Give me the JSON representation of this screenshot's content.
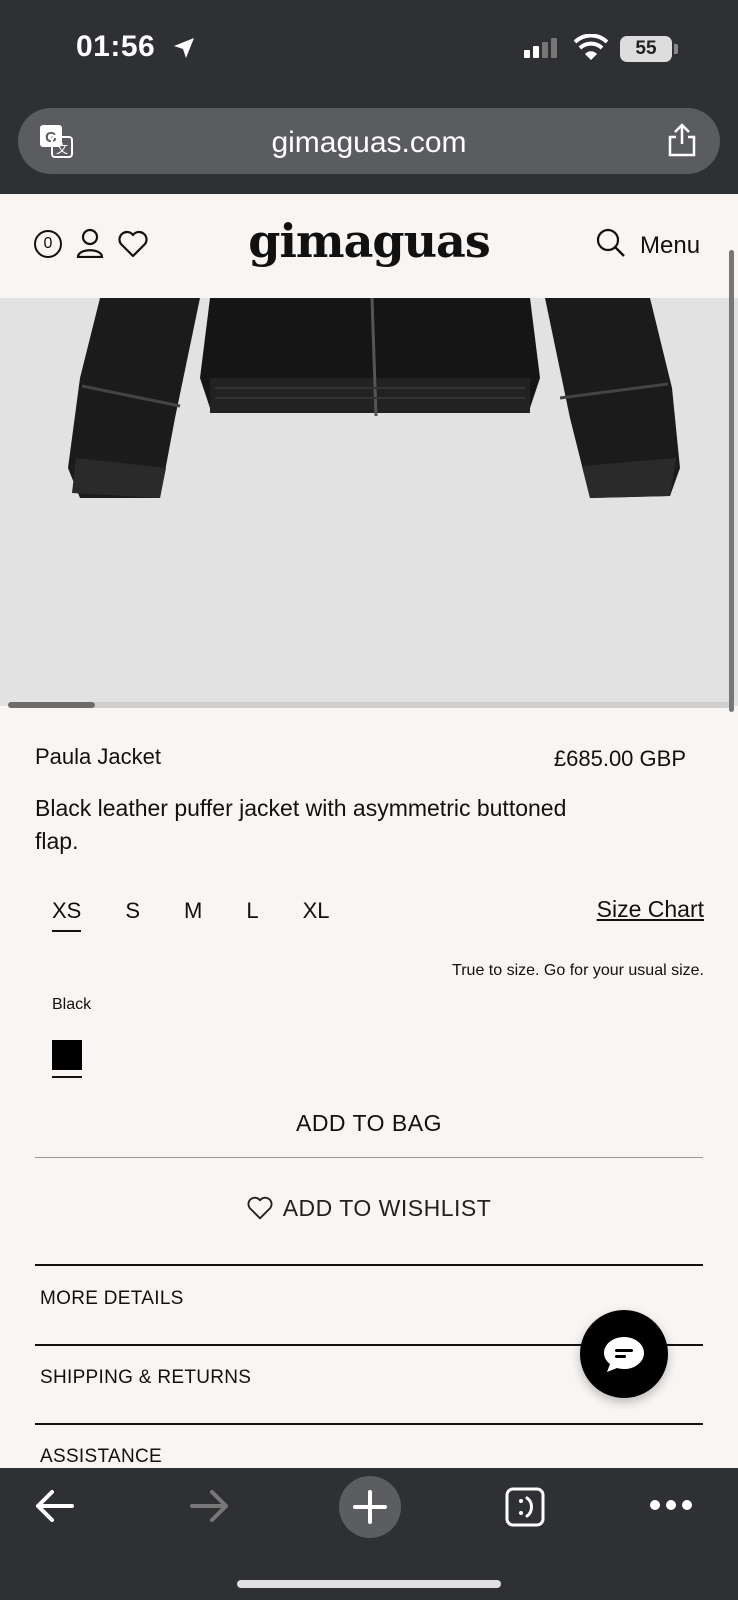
{
  "status_bar": {
    "time": "01:56",
    "battery": "55"
  },
  "browser": {
    "url": "gimaguas.com"
  },
  "header": {
    "cart_count": "0",
    "logo": "gimaguas",
    "menu_label": "Menu"
  },
  "product": {
    "name": "Paula Jacket",
    "price": "£685.00 GBP",
    "description": "Black leather puffer jacket with asymmetric buttoned flap.",
    "sizes": [
      "XS",
      "S",
      "M",
      "L",
      "XL"
    ],
    "selected_size": "XS",
    "size_chart_label": "Size Chart",
    "fit_note": "True to size. Go for your usual size.",
    "color_label": "Black",
    "swatch_color": "#000000",
    "image_carousel_progress": 0.12
  },
  "actions": {
    "add_to_bag": "ADD TO BAG",
    "add_to_wishlist": "ADD TO WISHLIST"
  },
  "accordion": [
    {
      "label": "MORE DETAILS"
    },
    {
      "label": "SHIPPING & RETURNS"
    },
    {
      "label": "ASSISTANCE"
    }
  ],
  "icons": {
    "status": [
      "location-arrow-icon",
      "signal-icon",
      "wifi-icon",
      "battery-icon"
    ],
    "browser": [
      "translate-icon",
      "share-icon"
    ],
    "header": [
      "user-icon",
      "heart-icon",
      "search-icon"
    ],
    "chat": "chat-icon",
    "toolbar": [
      "back-icon",
      "forward-icon",
      "plus-icon",
      "tabs-icon",
      "more-icon"
    ]
  }
}
